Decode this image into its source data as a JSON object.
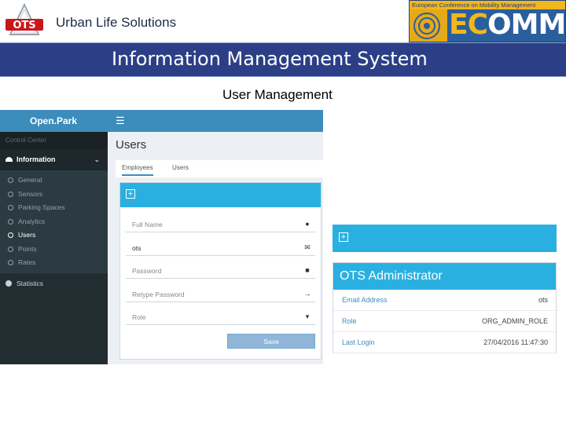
{
  "header": {
    "brand_name": "Urban Life Solutions",
    "logo_text": "OTS",
    "partner_banner": "European Conference on Mobility Management",
    "partner_logo_prefix": "EC",
    "partner_logo_suffix": "OMM"
  },
  "title": "Information Management System",
  "subtitle": "User Management",
  "app": {
    "name": "Open.Park",
    "caption": "Control Center",
    "section": "Information",
    "sub_items": [
      "General",
      "Sensors",
      "Parking Spaces",
      "Analytics",
      "Users",
      "Points",
      "Rates"
    ],
    "active_index": 4,
    "statistics": "Statistics",
    "page_title": "Users",
    "tabs": [
      "Employees",
      "Users"
    ],
    "form": {
      "full_name_placeholder": "Full Name",
      "email_value": "ots",
      "password_placeholder": "Password",
      "retype_placeholder": "Retype Password",
      "role_placeholder": "Role",
      "save_label": "Save"
    },
    "profile": {
      "name": "OTS Administrator",
      "rows": [
        {
          "key": "Email Address",
          "value": "ots"
        },
        {
          "key": "Role",
          "value": "ORG_ADMIN_ROLE"
        },
        {
          "key": "Last Login",
          "value": "27/04/2016 11:47:30"
        }
      ]
    }
  },
  "colors": {
    "title_bar": "#2c3f86",
    "app_primary": "#3c8dbc",
    "card_header": "#2ab0e0",
    "sidebar_bg": "#222d32"
  }
}
